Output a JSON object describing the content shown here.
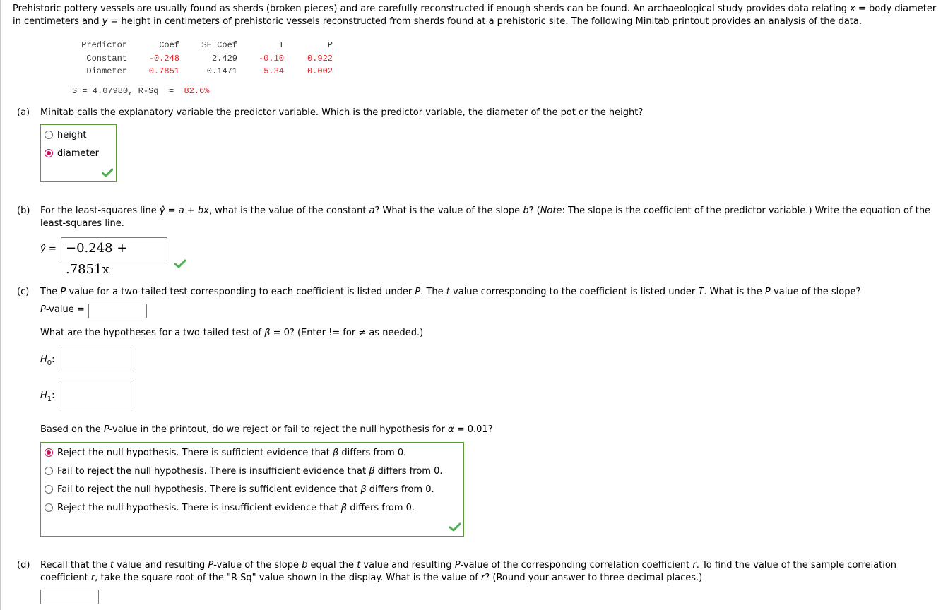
{
  "intro": {
    "text_1": "Prehistoric pottery vessels are usually found as sherds (broken pieces) and are carefully reconstructed if enough sherds can be found. An archaeological study provides data relating ",
    "var_x": "x",
    "text_2": " = body diameter in centimeters and ",
    "var_y": "y",
    "text_3": " = height in centimeters of prehistoric vessels reconstructed from sherds found at a prehistoric site. The following Minitab printout provides an analysis of the data."
  },
  "minitab": {
    "headers": [
      "Predictor",
      "Coef",
      "SE Coef",
      "T",
      "P"
    ],
    "rows": [
      [
        "Constant",
        "-0.248",
        "2.429",
        "-0.10",
        "0.922"
      ],
      [
        "Diameter",
        "0.7851",
        "0.1471",
        "5.34",
        "0.002"
      ]
    ],
    "s_label": "S = 4.07980, R-Sq  =  ",
    "rsq_value": "82.6%"
  },
  "part_a": {
    "label": "(a)",
    "question": "Minitab calls the explanatory variable the predictor variable. Which is the predictor variable, the diameter of the pot or the height?",
    "options": [
      {
        "label": "height",
        "selected": false
      },
      {
        "label": "diameter",
        "selected": true
      }
    ],
    "status": "correct"
  },
  "part_b": {
    "label": "(b)",
    "q_1": "For the least-squares line ",
    "yhat": "ŷ",
    "q_2": " = ",
    "a": "a",
    "q_3": " + ",
    "bx": "bx",
    "q_4": ", what is the value of the constant ",
    "q_5": "? What is the value of the slope ",
    "b": "b",
    "q_6": "? (",
    "note": "Note",
    "q_7": ": The slope is the coefficient of the predictor variable.) Write the equation of the least-squares line.",
    "answer_prefix": "ŷ =",
    "answer_value": "−0.248 + .7851x",
    "status": "correct"
  },
  "part_c": {
    "label": "(c)",
    "q_1": "The ",
    "P": "P",
    "q_2": "-value for a two-tailed test corresponding to each coefficient is listed under ",
    "q_3": ". The ",
    "t": "t",
    "q_4": " value corresponding to the coefficient is listed under ",
    "T": "T",
    "q_5": ". What is the ",
    "q_6": "-value of the slope?",
    "pvalue_label": "-value =",
    "pvalue_input": "",
    "hyp_q_1": "What are the hypotheses for a two-tailed test of ",
    "beta": "β",
    "hyp_q_2": " = 0? (Enter != for ≠ as needed.)",
    "h0_label": "H",
    "h0_sub": "0",
    "h1_label": "H",
    "h1_sub": "1",
    "h0_input": "",
    "h1_input": "",
    "decision_q_1": "Based on the ",
    "decision_q_2": "-value in the printout, do we reject or fail to reject the null hypothesis for ",
    "alpha": "α",
    "decision_q_3": " = 0.01?",
    "options": [
      {
        "pre": "Reject the null hypothesis. There is sufficient evidence that ",
        "post": " differs from 0.",
        "selected": true
      },
      {
        "pre": "Fail to reject the null hypothesis. There is insufficient evidence that ",
        "post": " differs from 0.",
        "selected": false
      },
      {
        "pre": "Fail to reject the null hypothesis. There is sufficient evidence that ",
        "post": " differs from 0.",
        "selected": false
      },
      {
        "pre": "Reject the null hypothesis. There is insufficient evidence that ",
        "post": " differs from 0.",
        "selected": false
      }
    ],
    "status": "correct"
  },
  "part_d": {
    "label": "(d)",
    "q_1": "Recall that the ",
    "t": "t",
    "q_2": " value and resulting ",
    "P": "P",
    "q_3": "-value of the slope ",
    "b": "b",
    "q_4": " equal the ",
    "q_5": " value and resulting ",
    "q_6": "-value of the corresponding correlation coefficient ",
    "r": "r",
    "q_7": ". To find the value of the sample correlation coefficient ",
    "q_8": ", take the square root of the \"R-Sq\" value shown in the display. What is the value of ",
    "q_9": "? (Round your answer to three decimal places.)",
    "r_input": ""
  },
  "colors": {
    "correct_border": "#5b9a3a",
    "check_green": "#4caf50",
    "selected_radio": "#c7105d",
    "minitab_highlight": "#e8202a"
  }
}
